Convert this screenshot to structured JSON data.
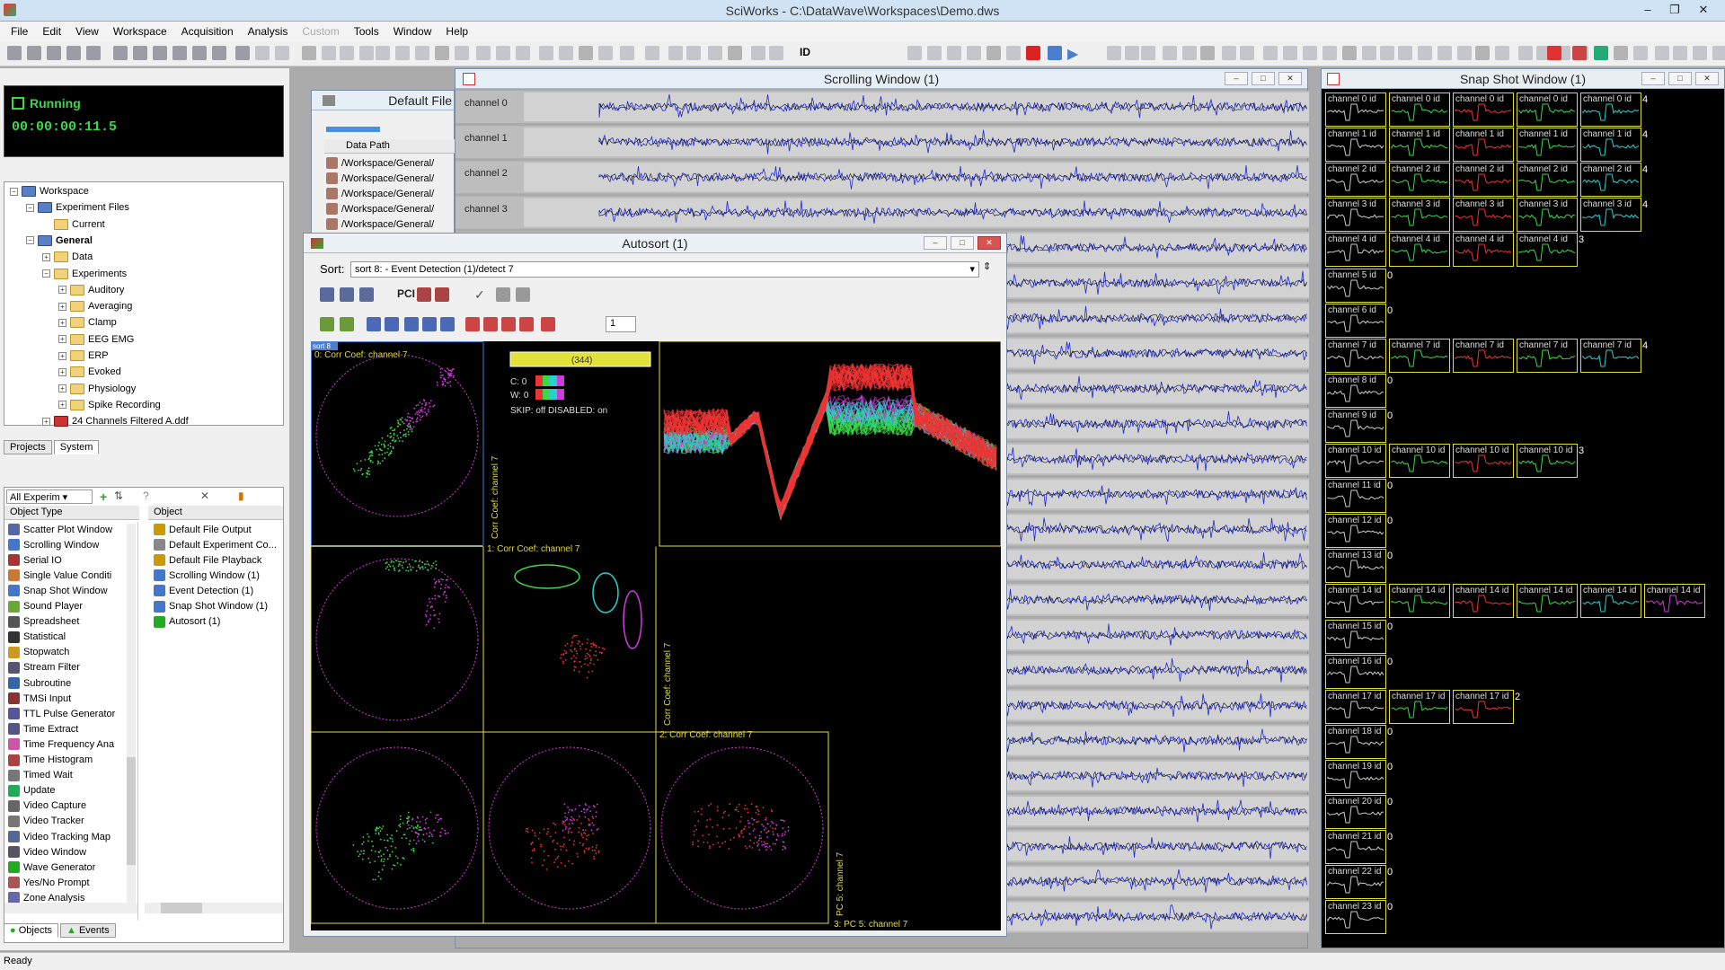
{
  "app": {
    "title": "SciWorks - C:\\DataWave\\Workspaces\\Demo.dws"
  },
  "menu": [
    "File",
    "Edit",
    "View",
    "Workspace",
    "Acquisition",
    "Analysis",
    "Custom",
    "Tools",
    "Window",
    "Help"
  ],
  "toolbar": {
    "id_label": "ID"
  },
  "status": {
    "state": "Running",
    "time": "00:00:00:11.5"
  },
  "tree": {
    "items": [
      {
        "label": "Workspace",
        "depth": 0,
        "exp": "−"
      },
      {
        "label": "Experiment Files",
        "depth": 1,
        "exp": "−"
      },
      {
        "label": "Current",
        "depth": 2,
        "exp": ""
      },
      {
        "label": "General",
        "depth": 1,
        "exp": "−"
      },
      {
        "label": "Data",
        "depth": 2,
        "exp": "+"
      },
      {
        "label": "Experiments",
        "depth": 2,
        "exp": "−"
      },
      {
        "label": "Auditory",
        "depth": 3,
        "exp": "+"
      },
      {
        "label": "Averaging",
        "depth": 3,
        "exp": "+"
      },
      {
        "label": "Clamp",
        "depth": 3,
        "exp": "+"
      },
      {
        "label": "EEG EMG",
        "depth": 3,
        "exp": "+"
      },
      {
        "label": "ERP",
        "depth": 3,
        "exp": "+"
      },
      {
        "label": "Evoked",
        "depth": 3,
        "exp": "+"
      },
      {
        "label": "Physiology",
        "depth": 3,
        "exp": "+"
      },
      {
        "label": "Spike Recording",
        "depth": 3,
        "exp": "+"
      },
      {
        "label": "24 Channels Filtered A.ddf",
        "depth": 2,
        "exp": "+"
      }
    ],
    "tabs": [
      "Projects",
      "System"
    ]
  },
  "objects": {
    "filter": "All Experim",
    "col_type": "Object Type",
    "col_object": "Object",
    "types": [
      "Scatter Plot Window",
      "Scrolling Window",
      "Serial IO",
      "Single Value Conditi",
      "Snap Shot Window",
      "Sound Player",
      "Spreadsheet",
      "Statistical",
      "Stopwatch",
      "Stream Filter",
      "Subroutine",
      "TMSi Input",
      "TTL Pulse Generator",
      "Time Extract",
      "Time Frequency Ana",
      "Time Histogram",
      "Timed Wait",
      "Update",
      "Video Capture",
      "Video Tracker",
      "Video Tracking Map",
      "Video Window",
      "Wave Generator",
      "Yes/No Prompt",
      "Zone Analysis"
    ],
    "objects": [
      "Default File Output",
      "Default Experiment Co...",
      "Default File Playback",
      "Scrolling Window (1)",
      "Event Detection (1)",
      "Snap Shot Window (1)",
      "Autosort (1)"
    ],
    "tabs": [
      "Objects",
      "Events"
    ]
  },
  "defaultfile": {
    "title": "Default File",
    "col": "Data Path",
    "paths": [
      "/Workspace/General/",
      "/Workspace/General/",
      "/Workspace/General/",
      "/Workspace/General/",
      "/Workspace/General/"
    ]
  },
  "scrolling": {
    "title": "Scrolling Window (1)",
    "channels": [
      "channel 0",
      "channel 1",
      "channel 2",
      "channel 3"
    ]
  },
  "snapshot": {
    "title": "Snap Shot Window (1)",
    "rows": [
      {
        "label": "channel 0 id",
        "n": 5,
        "count": "4"
      },
      {
        "label": "channel 1 id",
        "n": 5,
        "count": "4"
      },
      {
        "label": "channel 2 id",
        "n": 5,
        "count": "4"
      },
      {
        "label": "channel 3 id",
        "n": 5,
        "count": "4"
      },
      {
        "label": "channel 4 id",
        "n": 4,
        "count": "3"
      },
      {
        "label": "channel 5 id",
        "n": 1,
        "count": "0"
      },
      {
        "label": "channel 6 id",
        "n": 1,
        "count": "0"
      },
      {
        "label": "channel 7 id",
        "n": 5,
        "count": "4"
      },
      {
        "label": "channel 8 id",
        "n": 1,
        "count": "0"
      },
      {
        "label": "channel 9 id",
        "n": 1,
        "count": "0"
      },
      {
        "label": "channel 10 id",
        "n": 4,
        "count": "3"
      },
      {
        "label": "channel 11 id",
        "n": 1,
        "count": "0"
      },
      {
        "label": "channel 12 id",
        "n": 1,
        "count": "0"
      },
      {
        "label": "channel 13 id",
        "n": 1,
        "count": "0"
      },
      {
        "label": "channel 14 id",
        "n": 6,
        "count": ""
      },
      {
        "label": "channel 15 id",
        "n": 1,
        "count": "0"
      },
      {
        "label": "channel 16 id",
        "n": 1,
        "count": "0"
      },
      {
        "label": "channel 17 id",
        "n": 3,
        "count": "2"
      },
      {
        "label": "channel 18 id",
        "n": 1,
        "count": "0"
      },
      {
        "label": "channel 19 id",
        "n": 1,
        "count": "0"
      },
      {
        "label": "channel 20 id",
        "n": 1,
        "count": "0"
      },
      {
        "label": "channel 21 id",
        "n": 1,
        "count": "0"
      },
      {
        "label": "channel 22 id",
        "n": 1,
        "count": "0"
      },
      {
        "label": "channel 23 id",
        "n": 1,
        "count": "0"
      }
    ]
  },
  "autosort": {
    "title": "Autosort (1)",
    "sort_label": "Sort:",
    "sort_value": "sort 8:  - Event Detection (1)/detect 7",
    "sort_tag": "sort 8",
    "count": "(344)",
    "c_label": "C: 0",
    "w_label": "W: 0",
    "skip": "SKIP:  off    DISABLED:  on",
    "pci": "PCI",
    "spin": "1",
    "lbl0": "0:  Corr Coef:  channel 7",
    "lbl1": "1:  Corr Coef:  channel 7",
    "lbl2": "2:  Corr Coef:  channel 7",
    "lbl3": "3:  PC 5:  channel 7",
    "vlbl1": "Corr Coef:  channel 7",
    "vlbl2": "Corr Coef:  channel 7",
    "vlbl3": "PC 5:  channel 7"
  },
  "statusbar": "Ready",
  "colors": {
    "accent": "#e3dd3a",
    "trace": "#1f2ad0",
    "bg_dark": "#000000",
    "running": "#39d94a"
  }
}
